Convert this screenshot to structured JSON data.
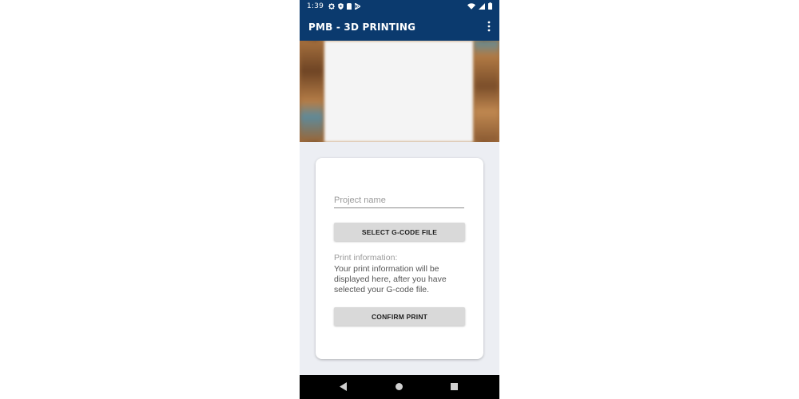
{
  "status_bar": {
    "time": "1:39",
    "left_icons": [
      "settings-gear-icon",
      "shield-icon",
      "sim-card-icon",
      "play-store-icon"
    ],
    "right_icons": [
      "wifi-icon",
      "signal-icon",
      "battery-icon"
    ]
  },
  "app_bar": {
    "title": "PMB - 3D PRINTING",
    "menu_icon": "more-vert-icon"
  },
  "form": {
    "project_name_placeholder": "Project name",
    "project_name_value": "",
    "select_gcode_label": "SELECT G-CODE FILE",
    "print_info_label": "Print information:",
    "print_info_text": "Your print information will be displayed here, after you have selected your G-code file.",
    "confirm_label": "CONFIRM PRINT"
  },
  "nav_bar": {
    "icons": [
      "back-icon",
      "home-icon",
      "recents-icon"
    ]
  },
  "colors": {
    "primary": "#0b3a6e",
    "background": "#eceef3",
    "button": "#d9d9d9"
  }
}
